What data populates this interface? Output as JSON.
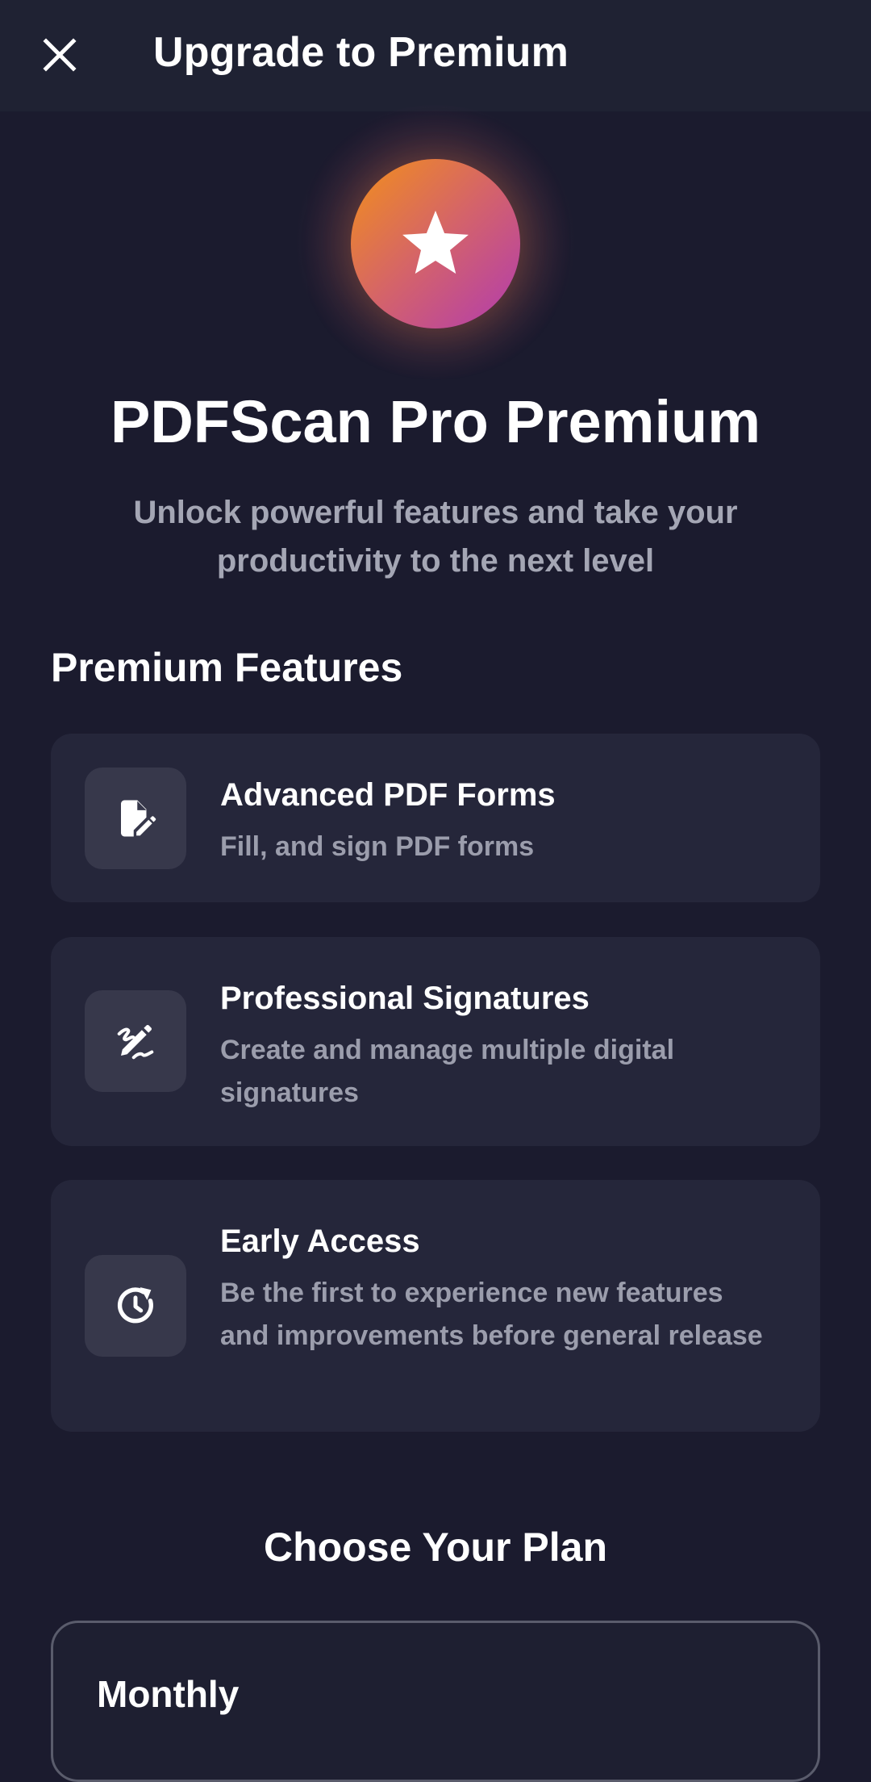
{
  "appbar": {
    "title": "Upgrade to Premium",
    "close_icon": "close-icon"
  },
  "hero": {
    "icon": "star-icon",
    "gradient_colors": [
      "#f39019",
      "#d4636a",
      "#b13bb0"
    ],
    "title": "PDFScan Pro Premium",
    "subtitle": "Unlock powerful features and take your productivity to the next level"
  },
  "features": {
    "heading": "Premium Features",
    "items": [
      {
        "icon": "edit-document-icon",
        "title": "Advanced PDF Forms",
        "description": "Fill, and sign PDF forms"
      },
      {
        "icon": "signature-icon",
        "title": "Professional Signatures",
        "description": "Create and manage multiple digital signatures"
      },
      {
        "icon": "update-clock-icon",
        "title": "Early Access",
        "description": "Be the first to experience new features and improvements before general release"
      }
    ]
  },
  "plans": {
    "heading": "Choose Your Plan",
    "items": [
      {
        "name": "Monthly"
      }
    ]
  },
  "colors": {
    "background": "#1b1b2e",
    "appbar": "#1f2233",
    "card": "#25263a",
    "muted_text": "#9b9dac"
  }
}
